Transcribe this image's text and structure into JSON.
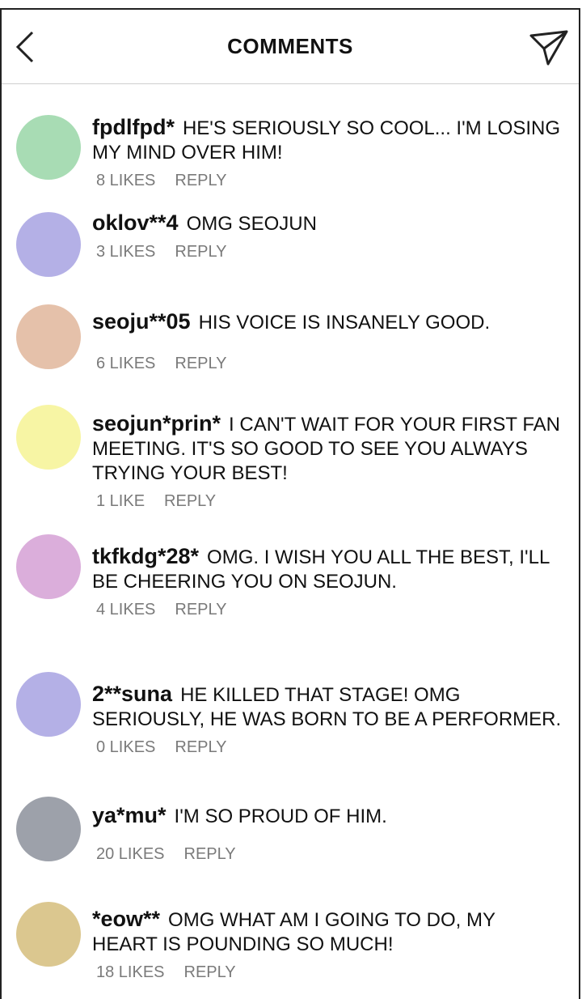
{
  "header": {
    "title": "COMMENTS"
  },
  "comments": [
    {
      "user": "fpdlfpd*",
      "text": "HE'S SERIOUSLY SO COOL... I'M LOSING MY MIND OVER HIM!",
      "likes": "8 LIKES",
      "reply": "REPLY",
      "avatar_color": "#a8dcb4"
    },
    {
      "user": "oklov**4",
      "text": "OMG SEOJUN",
      "likes": "3 LIKES",
      "reply": "REPLY",
      "avatar_color": "#b4b0e6"
    },
    {
      "user": "seoju**05",
      "text": "HIS VOICE IS INSANELY GOOD.",
      "likes": "6 LIKES",
      "reply": "REPLY",
      "avatar_color": "#e5c1aa"
    },
    {
      "user": "seojun*prin*",
      "text": "I CAN'T WAIT FOR YOUR FIRST FAN MEETING. IT'S SO GOOD TO SEE YOU ALWAYS TRYING YOUR BEST!",
      "likes": "1 LIKE",
      "reply": "REPLY",
      "avatar_color": "#f7f5a4"
    },
    {
      "user": "tkfkdg*28*",
      "text": "OMG. I WISH YOU ALL THE BEST, I'LL BE CHEERING YOU ON SEOJUN.",
      "likes": "4 LIKES",
      "reply": "REPLY",
      "avatar_color": "#dbaedb"
    },
    {
      "user": "2**suna",
      "text": "HE KILLED THAT STAGE! OMG SERIOUSLY, HE WAS BORN TO BE A PERFORMER.",
      "likes": "0 LIKES",
      "reply": "REPLY",
      "avatar_color": "#b4b0e6"
    },
    {
      "user": "ya*mu*",
      "text": "I'M SO PROUD OF HIM.",
      "likes": "20 LIKES",
      "reply": "REPLY",
      "avatar_color": "#9da1aa"
    },
    {
      "user": "*eow**",
      "text": "OMG WHAT AM I GOING TO DO, MY HEART IS POUNDING SO MUCH!",
      "likes": "18 LIKES",
      "reply": "REPLY",
      "avatar_color": "#dbc78f"
    }
  ]
}
